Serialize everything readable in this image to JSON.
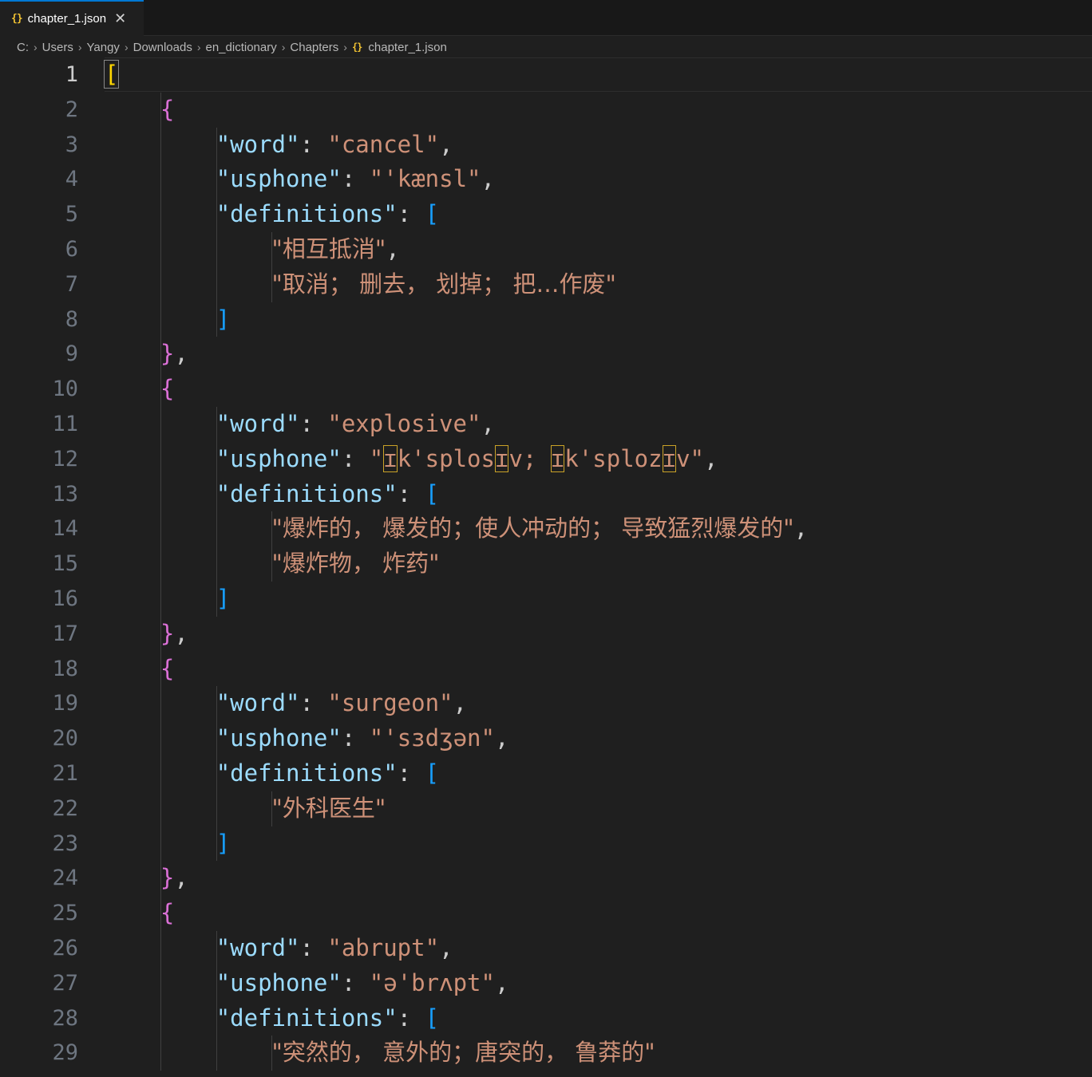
{
  "tab": {
    "icon": "json-icon",
    "label": "chapter_1.json",
    "close_icon": "close-icon"
  },
  "breadcrumb": [
    "C:",
    "Users",
    "Yangy",
    "Downloads",
    "en_dictionary",
    "Chapters",
    "chapter_1.json"
  ],
  "line_numbers": [
    "1",
    "2",
    "3",
    "4",
    "5",
    "6",
    "7",
    "8",
    "9",
    "10",
    "11",
    "12",
    "13",
    "14",
    "15",
    "16",
    "17",
    "18",
    "19",
    "20",
    "21",
    "22",
    "23",
    "24",
    "25",
    "26",
    "27",
    "28",
    "29"
  ],
  "entries": [
    {
      "word": "cancel",
      "usphone": "'kænsl",
      "definitions": [
        "相互抵消",
        "取消； 删去， 划掉； 把…作废"
      ]
    },
    {
      "word": "explosive",
      "usphone": "ɪk'splosɪv; ɪk'splozɪv",
      "definitions": [
        "爆炸的， 爆发的；使人冲动的； 导致猛烈爆发的",
        "爆炸物， 炸药"
      ]
    },
    {
      "word": "surgeon",
      "usphone": "'sɜdʒən",
      "definitions": [
        "外科医生"
      ]
    },
    {
      "word": "abrupt",
      "usphone": "ə'brʌpt",
      "definitions": [
        "突然的， 意外的；唐突的， 鲁莽的"
      ]
    }
  ],
  "colors": {
    "key": "#9cdcfe",
    "string": "#ce9178",
    "bracket_level1": "#ffd700",
    "bracket_level2": "#da70d6",
    "bracket_level3": "#179fff",
    "background": "#1f1f1f"
  }
}
